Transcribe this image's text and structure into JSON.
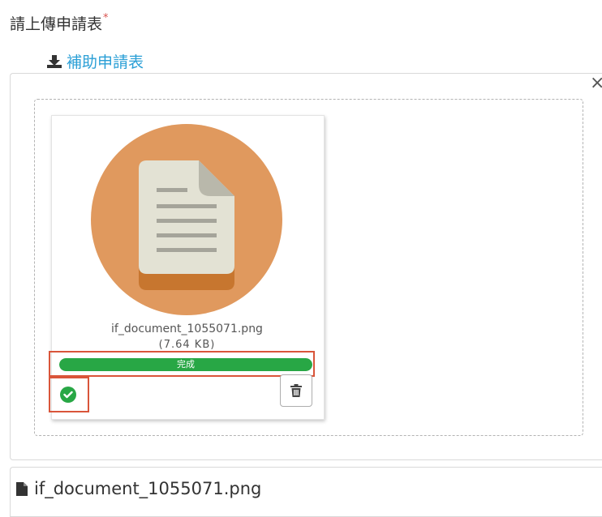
{
  "form": {
    "label": "請上傳申請表",
    "required_mark": "*",
    "download_link": "補助申請表"
  },
  "uploader": {
    "close_symbol": "×",
    "file": {
      "name": "if_document_1055071.png",
      "size": "(7.64 KB)",
      "progress_percent": 100,
      "status_text": "完成"
    },
    "icons": {
      "download": "download-icon",
      "file_preview": "document-icon",
      "success": "check-circle-icon",
      "delete": "trash-icon",
      "caption_file": "file-icon"
    }
  },
  "caption": {
    "filename": "if_document_1055071.png"
  },
  "colors": {
    "link": "#2a9fd6",
    "success": "#28a745",
    "highlight": "#d9553a",
    "required": "#d9534f",
    "thumb_circle": "#e0995e"
  }
}
